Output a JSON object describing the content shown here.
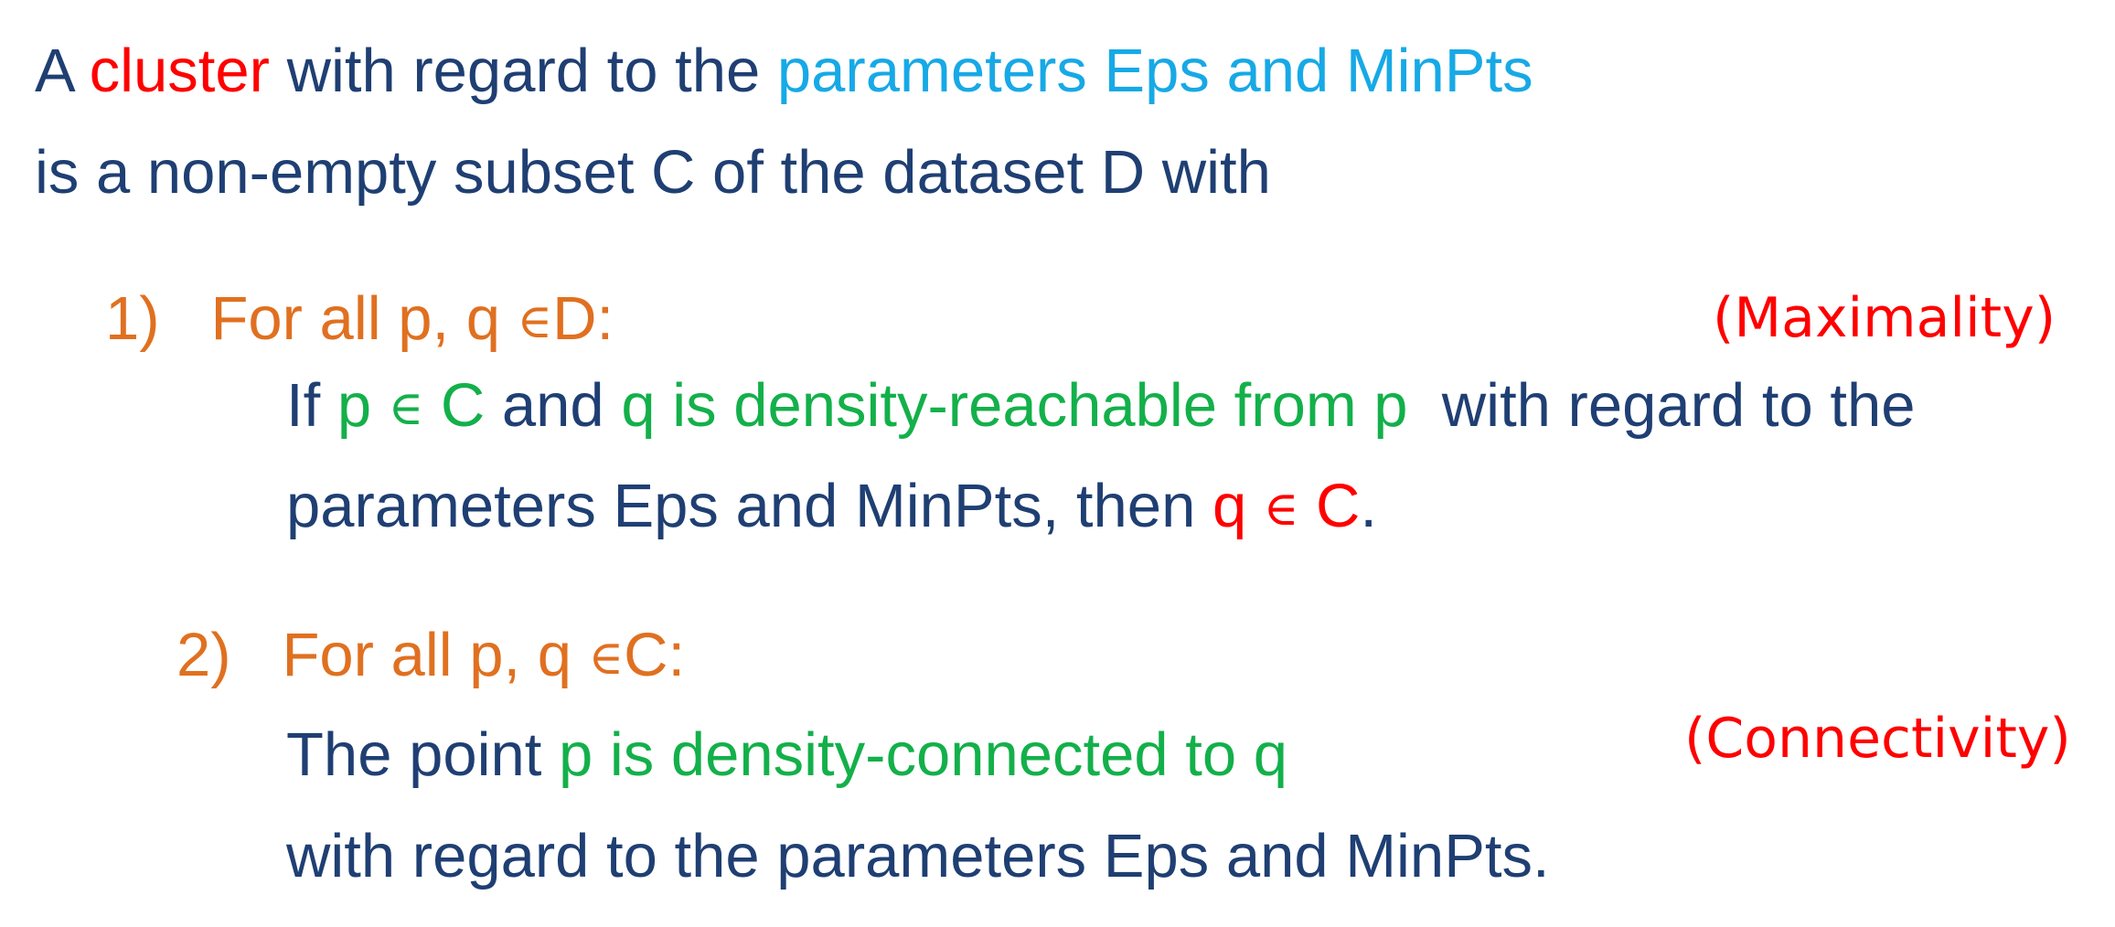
{
  "intro": {
    "line1": {
      "a": "A",
      "cluster": "cluster",
      "with_regard": "with regard to the",
      "params": "parameters Eps and MinPts"
    },
    "line2": "is a non-empty subset C of the dataset D with"
  },
  "condition1": {
    "number": "1)",
    "head_text": "For all p, q",
    "elem_symbol": "∈",
    "head_set": "D:",
    "tag": "(Maximality)",
    "body1": {
      "if": "If",
      "p_in": "p",
      "elem_symbol": "∈",
      "c": "C",
      "and": "and",
      "reach": "q is density-reachable from p",
      "rest": "with regard to the"
    },
    "body2": {
      "text": "parameters Eps and MinPts,  then",
      "q": "q",
      "elem_symbol": "∈",
      "c": "C",
      "dot": "."
    }
  },
  "condition2": {
    "number": "2)",
    "head_text": "For all p, q",
    "elem_symbol": "∈",
    "head_set": "C:",
    "tag": "(Connectivity)",
    "body1": {
      "the_point": "The point",
      "conn": "p is density-connected to q"
    },
    "body2": "with regard to the parameters Eps and MinPts."
  },
  "colors": {
    "navy": "#1f3f73",
    "red": "#ff0000",
    "cyan": "#17a9e6",
    "orange": "#e07020",
    "green": "#13b04a"
  }
}
